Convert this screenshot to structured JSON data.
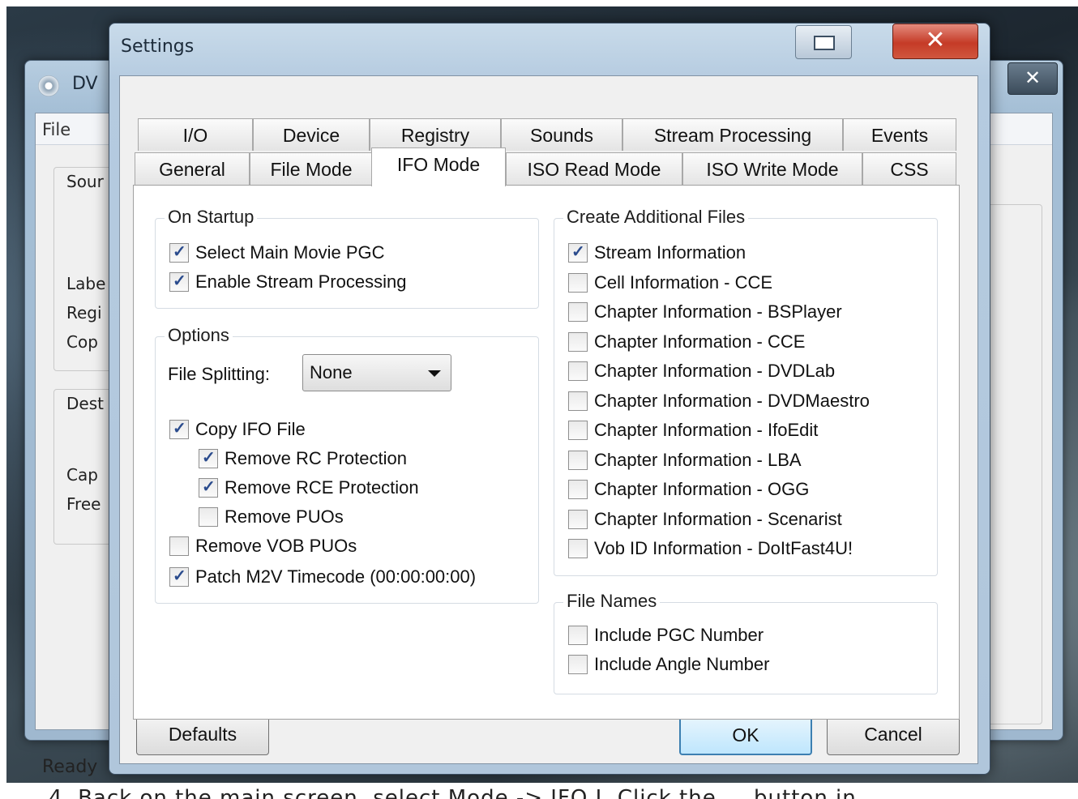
{
  "background_window": {
    "title": "DV",
    "close_glyph": "✕",
    "menu_file": "File",
    "labels": [
      "Sour",
      "Labe",
      "Regi",
      "Cop",
      "Dest",
      "Cap",
      "Free"
    ],
    "status": "Ready"
  },
  "dialog": {
    "title": "Settings",
    "close_glyph": "✕",
    "tabs_row1": [
      "I/O",
      "Device",
      "Registry",
      "Sounds",
      "Stream Processing",
      "Events"
    ],
    "tabs_row2": [
      "General",
      "File Mode",
      "IFO Mode",
      "ISO Read Mode",
      "ISO Write Mode",
      "CSS"
    ],
    "active_tab": "IFO Mode",
    "on_startup": {
      "title": "On Startup",
      "items": [
        {
          "label": "Select Main Movie PGC",
          "checked": true
        },
        {
          "label": "Enable Stream Processing",
          "checked": true
        }
      ]
    },
    "options": {
      "title": "Options",
      "file_splitting_label": "File Splitting:",
      "file_splitting_value": "None",
      "items": [
        {
          "label": "Copy IFO File",
          "checked": true
        },
        {
          "label": "Remove RC Protection",
          "checked": true
        },
        {
          "label": "Remove RCE Protection",
          "checked": true
        },
        {
          "label": "Remove PUOs",
          "checked": false
        },
        {
          "label": "Remove VOB PUOs",
          "checked": false
        },
        {
          "label": "Patch M2V Timecode (00:00:00:00)",
          "checked": true
        }
      ]
    },
    "create_additional_files": {
      "title": "Create Additional Files",
      "items": [
        {
          "label": "Stream Information",
          "checked": true
        },
        {
          "label": "Cell Information - CCE",
          "checked": false
        },
        {
          "label": "Chapter Information - BSPlayer",
          "checked": false
        },
        {
          "label": "Chapter Information - CCE",
          "checked": false
        },
        {
          "label": "Chapter Information - DVDLab",
          "checked": false
        },
        {
          "label": "Chapter Information - DVDMaestro",
          "checked": false
        },
        {
          "label": "Chapter Information - IfoEdit",
          "checked": false
        },
        {
          "label": "Chapter Information - LBA",
          "checked": false
        },
        {
          "label": "Chapter Information - OGG",
          "checked": false
        },
        {
          "label": "Chapter Information - Scenarist",
          "checked": false
        },
        {
          "label": "Vob ID Information - DoItFast4U!",
          "checked": false
        }
      ]
    },
    "file_names": {
      "title": "File Names",
      "items": [
        {
          "label": "Include PGC Number",
          "checked": false
        },
        {
          "label": "Include Angle Number",
          "checked": false
        }
      ]
    },
    "buttons": {
      "defaults": "Defaults",
      "ok": "OK",
      "cancel": "Cancel"
    }
  },
  "caption_fragment": "4.  Back on the main screen, select Mode -> IFO I. Click the ... button in ..."
}
